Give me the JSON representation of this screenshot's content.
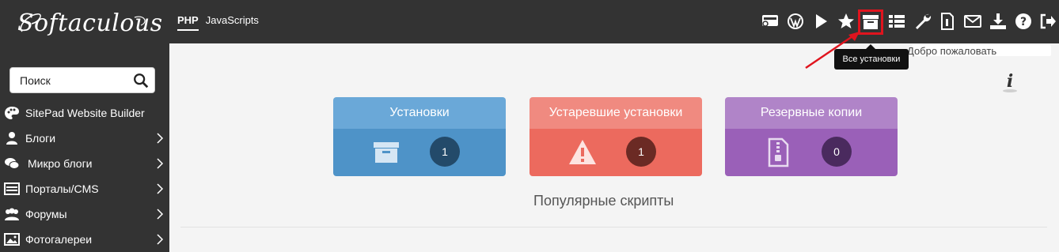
{
  "app": {
    "logo_text": "Softaculous"
  },
  "lang_tabs": [
    {
      "label": "PHP",
      "active": true
    },
    {
      "label": "JavaScripts",
      "active": false
    }
  ],
  "toolbar": {
    "icons": [
      "cpanel-icon",
      "wordpress-icon",
      "play-icon",
      "star-icon",
      "installations-box-icon",
      "list-icon",
      "wrench-icon",
      "document-icon",
      "envelope-icon",
      "download-icon",
      "help-icon",
      "logout-icon"
    ],
    "tooltip": "Все установки"
  },
  "welcome_text": "Добро пожаловать",
  "search": {
    "placeholder": "Поиск"
  },
  "sidebar": {
    "items": [
      {
        "label": "SitePad Website Builder",
        "icon": "palette-icon",
        "has_chevron": false
      },
      {
        "label": "Блоги",
        "icon": "user-icon",
        "has_chevron": true
      },
      {
        "label": "Микро блоги",
        "icon": "chat-icon",
        "has_chevron": true
      },
      {
        "label": "Порталы/CMS",
        "icon": "portal-icon",
        "has_chevron": true
      },
      {
        "label": "Форумы",
        "icon": "users-icon",
        "has_chevron": true
      },
      {
        "label": "Фотогалереи",
        "icon": "image-icon",
        "has_chevron": true
      }
    ]
  },
  "cards": {
    "installations": {
      "title": "Установки",
      "count": "1"
    },
    "outdated": {
      "title": "Устаревшие установки",
      "count": "1"
    },
    "backups": {
      "title": "Резервные копии",
      "count": "0"
    }
  },
  "popular_heading": "Популярные скрипты",
  "colors": {
    "topbar": "#333333",
    "highlight": "#e0141e",
    "installations": "#4e93c8",
    "outdated": "#ec6a5e",
    "backups": "#9a60b8"
  }
}
